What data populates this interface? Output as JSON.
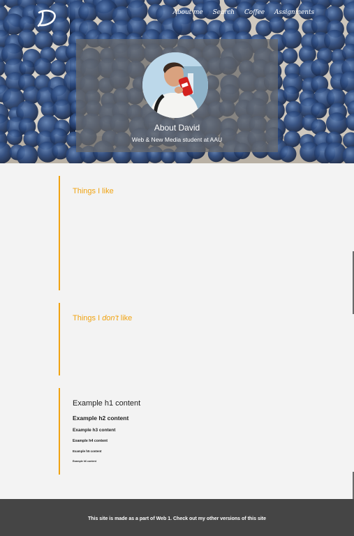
{
  "nav": {
    "logo": "logo-icon",
    "items": [
      {
        "label": "About me"
      },
      {
        "label": "Search"
      },
      {
        "label": "Coffee"
      },
      {
        "label": "Assignments"
      }
    ]
  },
  "profile": {
    "name": "About David",
    "subtitle": "Web & New Media student at AAU"
  },
  "sections": {
    "likes": {
      "title": "Things I like"
    },
    "dislikes": {
      "title_pre": "Things I ",
      "title_em": "don't",
      "title_post": " like"
    },
    "examples": {
      "h1": "Example h1 content",
      "h2": "Example h2 content",
      "h3": "Example h3 content",
      "h4": "Example h4 content",
      "h5": "Example h5 content",
      "h6": "Example h6 content"
    }
  },
  "footer": {
    "text": "This site is made as a part of Web 1. Check out my other versions of this site"
  },
  "colors": {
    "accent": "#f0a311",
    "footer_bg": "#454545",
    "page_bg": "#f3f3f3"
  }
}
